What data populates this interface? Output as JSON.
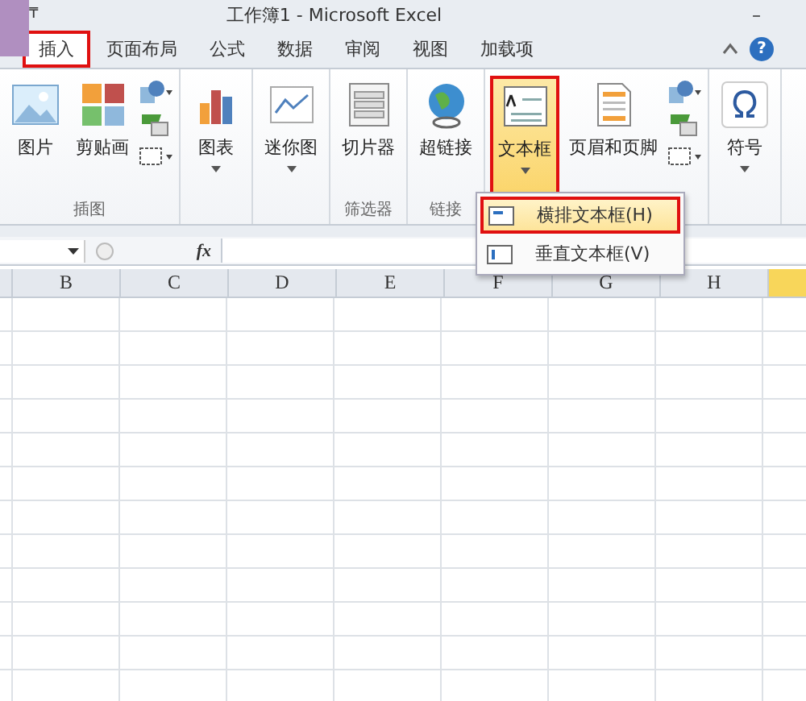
{
  "window": {
    "title": "工作簿1 - Microsoft Excel",
    "quick_access": "₸",
    "minimize": "–"
  },
  "tabs": [
    {
      "label": "插入",
      "selected": true,
      "highlighted": true
    },
    {
      "label": "页面布局",
      "selected": false,
      "highlighted": false
    },
    {
      "label": "公式",
      "selected": false,
      "highlighted": false
    },
    {
      "label": "数据",
      "selected": false,
      "highlighted": false
    },
    {
      "label": "审阅",
      "selected": false,
      "highlighted": false
    },
    {
      "label": "视图",
      "selected": false,
      "highlighted": false
    },
    {
      "label": "加载项",
      "selected": false,
      "highlighted": false
    }
  ],
  "help": "?",
  "ribbon_groups": [
    {
      "label": "插图",
      "buttons": [
        {
          "kind": "large",
          "label": "图片",
          "dropdown": false,
          "highlighted": false
        },
        {
          "kind": "large",
          "label": "剪贴画",
          "dropdown": false,
          "highlighted": false
        },
        {
          "kind": "stack"
        }
      ]
    },
    {
      "buttons": [
        {
          "kind": "large",
          "label": "图表",
          "dropdown": true,
          "highlighted": false
        }
      ]
    },
    {
      "buttons": [
        {
          "kind": "large",
          "label": "迷你图",
          "dropdown": true,
          "highlighted": false
        }
      ]
    },
    {
      "label": "筛选器",
      "buttons": [
        {
          "kind": "large",
          "label": "切片器",
          "dropdown": false,
          "highlighted": false
        }
      ]
    },
    {
      "label": "链接",
      "buttons": [
        {
          "kind": "large",
          "label": "超链接",
          "dropdown": false,
          "highlighted": false
        }
      ]
    },
    {
      "buttons": [
        {
          "kind": "large",
          "label": "文本框",
          "dropdown": true,
          "highlighted": true
        },
        {
          "kind": "large",
          "label": "页眉和页脚",
          "dropdown": false,
          "highlighted": false
        },
        {
          "kind": "stack"
        }
      ]
    },
    {
      "buttons": [
        {
          "kind": "large",
          "label": "符号",
          "dropdown": true,
          "highlighted": false
        }
      ]
    }
  ],
  "menu": {
    "items": [
      {
        "label": "横排文本框(H)",
        "selected": true,
        "highlighted": true
      },
      {
        "label": "垂直文本框(V)",
        "selected": false,
        "highlighted": false
      }
    ]
  },
  "formula_bar": {
    "fx": "fx"
  },
  "columns": [
    {
      "label": "B",
      "selected": false
    },
    {
      "label": "C",
      "selected": false
    },
    {
      "label": "D",
      "selected": false
    },
    {
      "label": "E",
      "selected": false
    },
    {
      "label": "F",
      "selected": false
    },
    {
      "label": "G",
      "selected": false
    },
    {
      "label": "H",
      "selected": false
    },
    {
      "selected": true
    }
  ]
}
